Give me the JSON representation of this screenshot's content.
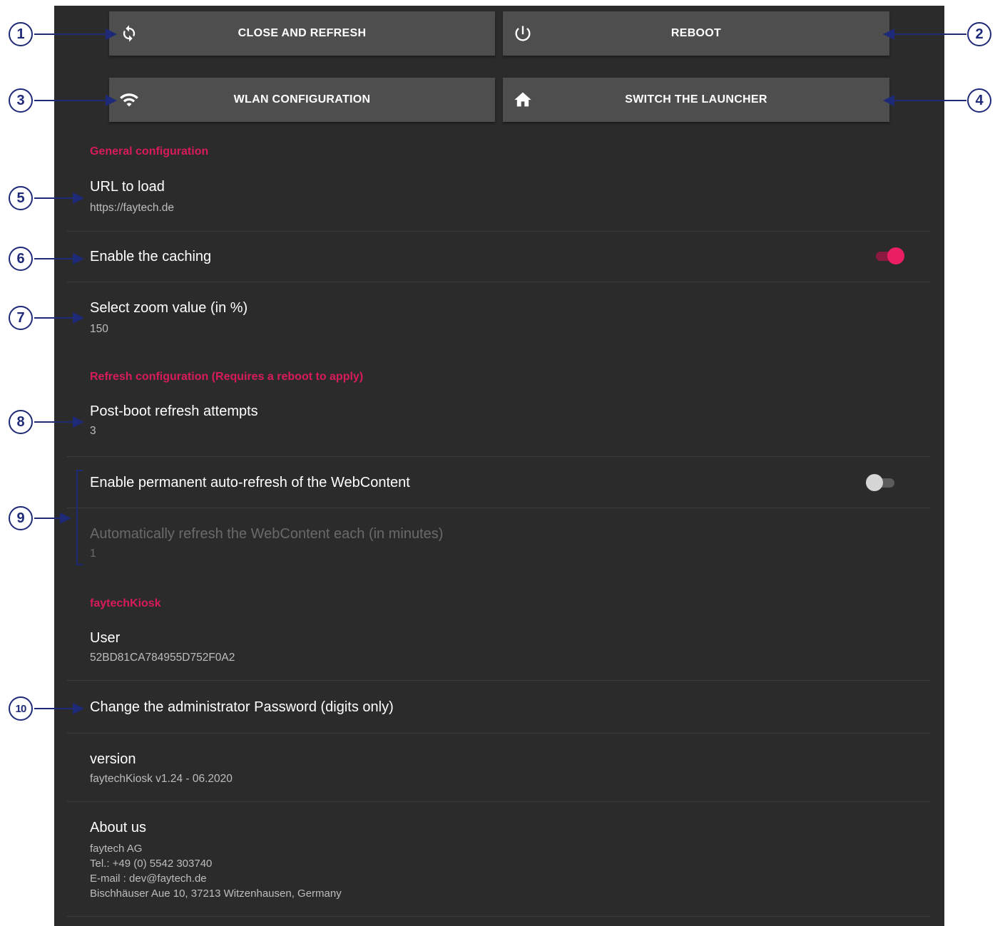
{
  "buttons": {
    "close_refresh": "CLOSE AND REFRESH",
    "reboot": "REBOOT",
    "wlan": "WLAN CONFIGURATION",
    "launcher": "SWITCH THE LAUNCHER"
  },
  "general": {
    "header": "General configuration",
    "url_title": "URL to load",
    "url_value": "https://faytech.de",
    "caching_title": "Enable the caching",
    "caching_enabled": true,
    "zoom_title": "Select zoom value (in %)",
    "zoom_value": "150"
  },
  "refresh": {
    "header": "Refresh configuration (Requires a reboot to apply)",
    "attempts_title": "Post-boot refresh attempts",
    "attempts_value": "3",
    "auto_title": "Enable permanent auto-refresh of the WebContent",
    "auto_enabled": false,
    "interval_title": "Automatically refresh the WebContent each (in minutes)",
    "interval_value": "1"
  },
  "kiosk": {
    "header": "faytechKiosk",
    "user_title": "User",
    "user_value": "52BD81CA784955D752F0A2",
    "password_title": "Change the administrator Password (digits only)",
    "version_title": "version",
    "version_value": "faytechKiosk v1.24 - 06.2020",
    "about_title": "About us",
    "about_lines": [
      "faytech AG",
      "Tel.: +49 (0) 5542 303740",
      "E-mail : dev@faytech.de",
      "Bischhäuser Aue 10, 37213 Witzenhausen, Germany"
    ]
  },
  "callouts": [
    "1",
    "2",
    "3",
    "4",
    "5",
    "6",
    "7",
    "8",
    "9",
    "10"
  ],
  "colors": {
    "panel": "#2b2b2b",
    "button": "#4e4e4e",
    "accent": "#d81b5a",
    "callout": "#1e2a78"
  },
  "icons": {
    "close_refresh": "refresh-icon",
    "reboot": "power-icon",
    "wlan": "wifi-icon",
    "launcher": "home-icon"
  }
}
